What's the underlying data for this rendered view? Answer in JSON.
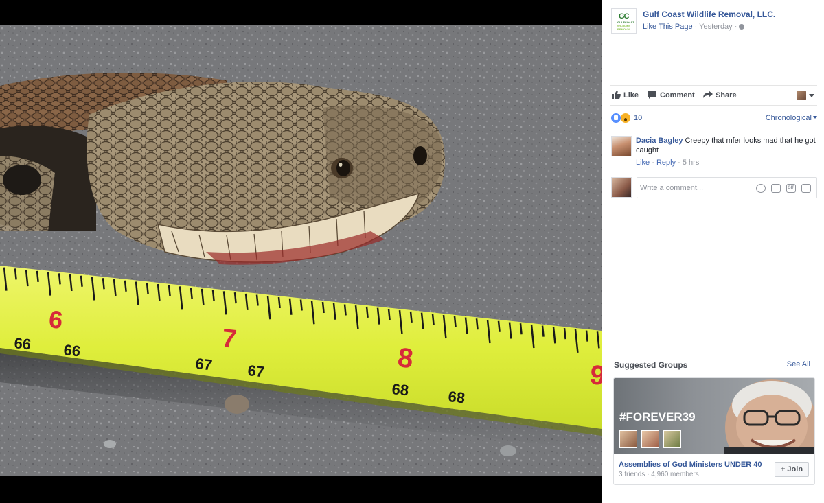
{
  "post": {
    "page_name": "Gulf Coast Wildlife Removal, LLC.",
    "logo_text": "GC",
    "logo_sub1": "GULFCOAST",
    "logo_sub2": "WILDLIFE REMOVAL",
    "like_page_label": "Like This Page",
    "separator": " · ",
    "timestamp": "Yesterday",
    "audience_icon": "globe-icon"
  },
  "photo": {
    "tape_numbers": [
      "6",
      "7",
      "8",
      "9"
    ],
    "tape_small_numbers": [
      "66",
      "66",
      "67",
      "67",
      "68",
      "68"
    ]
  },
  "actions": {
    "like_label": "Like",
    "comment_label": "Comment",
    "share_label": "Share"
  },
  "reactions": {
    "count": "10",
    "sort_label": "Chronological",
    "types": [
      "like-reaction-icon",
      "wow-reaction-icon"
    ]
  },
  "comment": {
    "author": "Dacia Bagley",
    "text": "Creepy that mfer looks mad that he got caught",
    "like_label": "Like",
    "reply_label": "Reply",
    "separator": " · ",
    "time": "5 hrs"
  },
  "composer": {
    "placeholder": "Write a comment..."
  },
  "suggested_groups": {
    "title": "Suggested Groups",
    "see_all_label": "See All",
    "cover_text": "#FOREVER39",
    "group_name": "Assemblies of God Ministers UNDER 40",
    "friends": "3 friends",
    "separator": " · ",
    "members": "4,960 members",
    "join_label": "+ Join"
  },
  "colors": {
    "link": "#365899",
    "tape_yellow": "#dfee3c",
    "tape_red_numbers": "#d62a3a"
  }
}
